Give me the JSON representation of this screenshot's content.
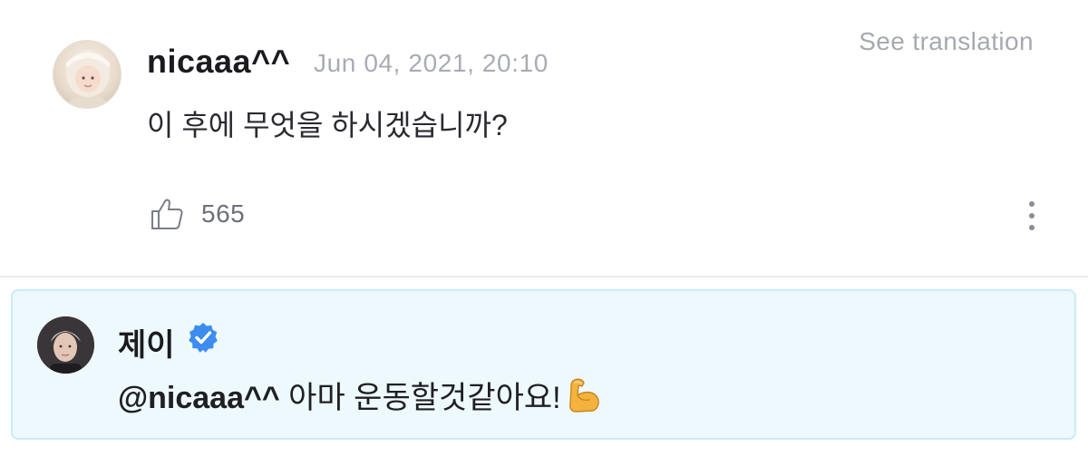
{
  "comment": {
    "username": "nicaaa^^",
    "timestamp": "Jun 04, 2021, 20:10",
    "translate_label": "See translation",
    "text": "이 후에 무엇을 하시겠습니까?",
    "like_count": "565",
    "icons": {
      "like": "thumbs-up-icon",
      "more": "vertical-ellipsis-icon"
    }
  },
  "reply": {
    "username": "제이",
    "verified_icon": "verified-badge-icon",
    "mention": "@nicaaa^^",
    "text": "아마 운동할것같아요!",
    "emoji": "flexed-biceps-emoji"
  },
  "colors": {
    "reply_background": "#eef9fd",
    "reply_border": "#c9ecf7",
    "verified_badge": "#3d8cf0",
    "muted_text": "#a9acb3"
  }
}
